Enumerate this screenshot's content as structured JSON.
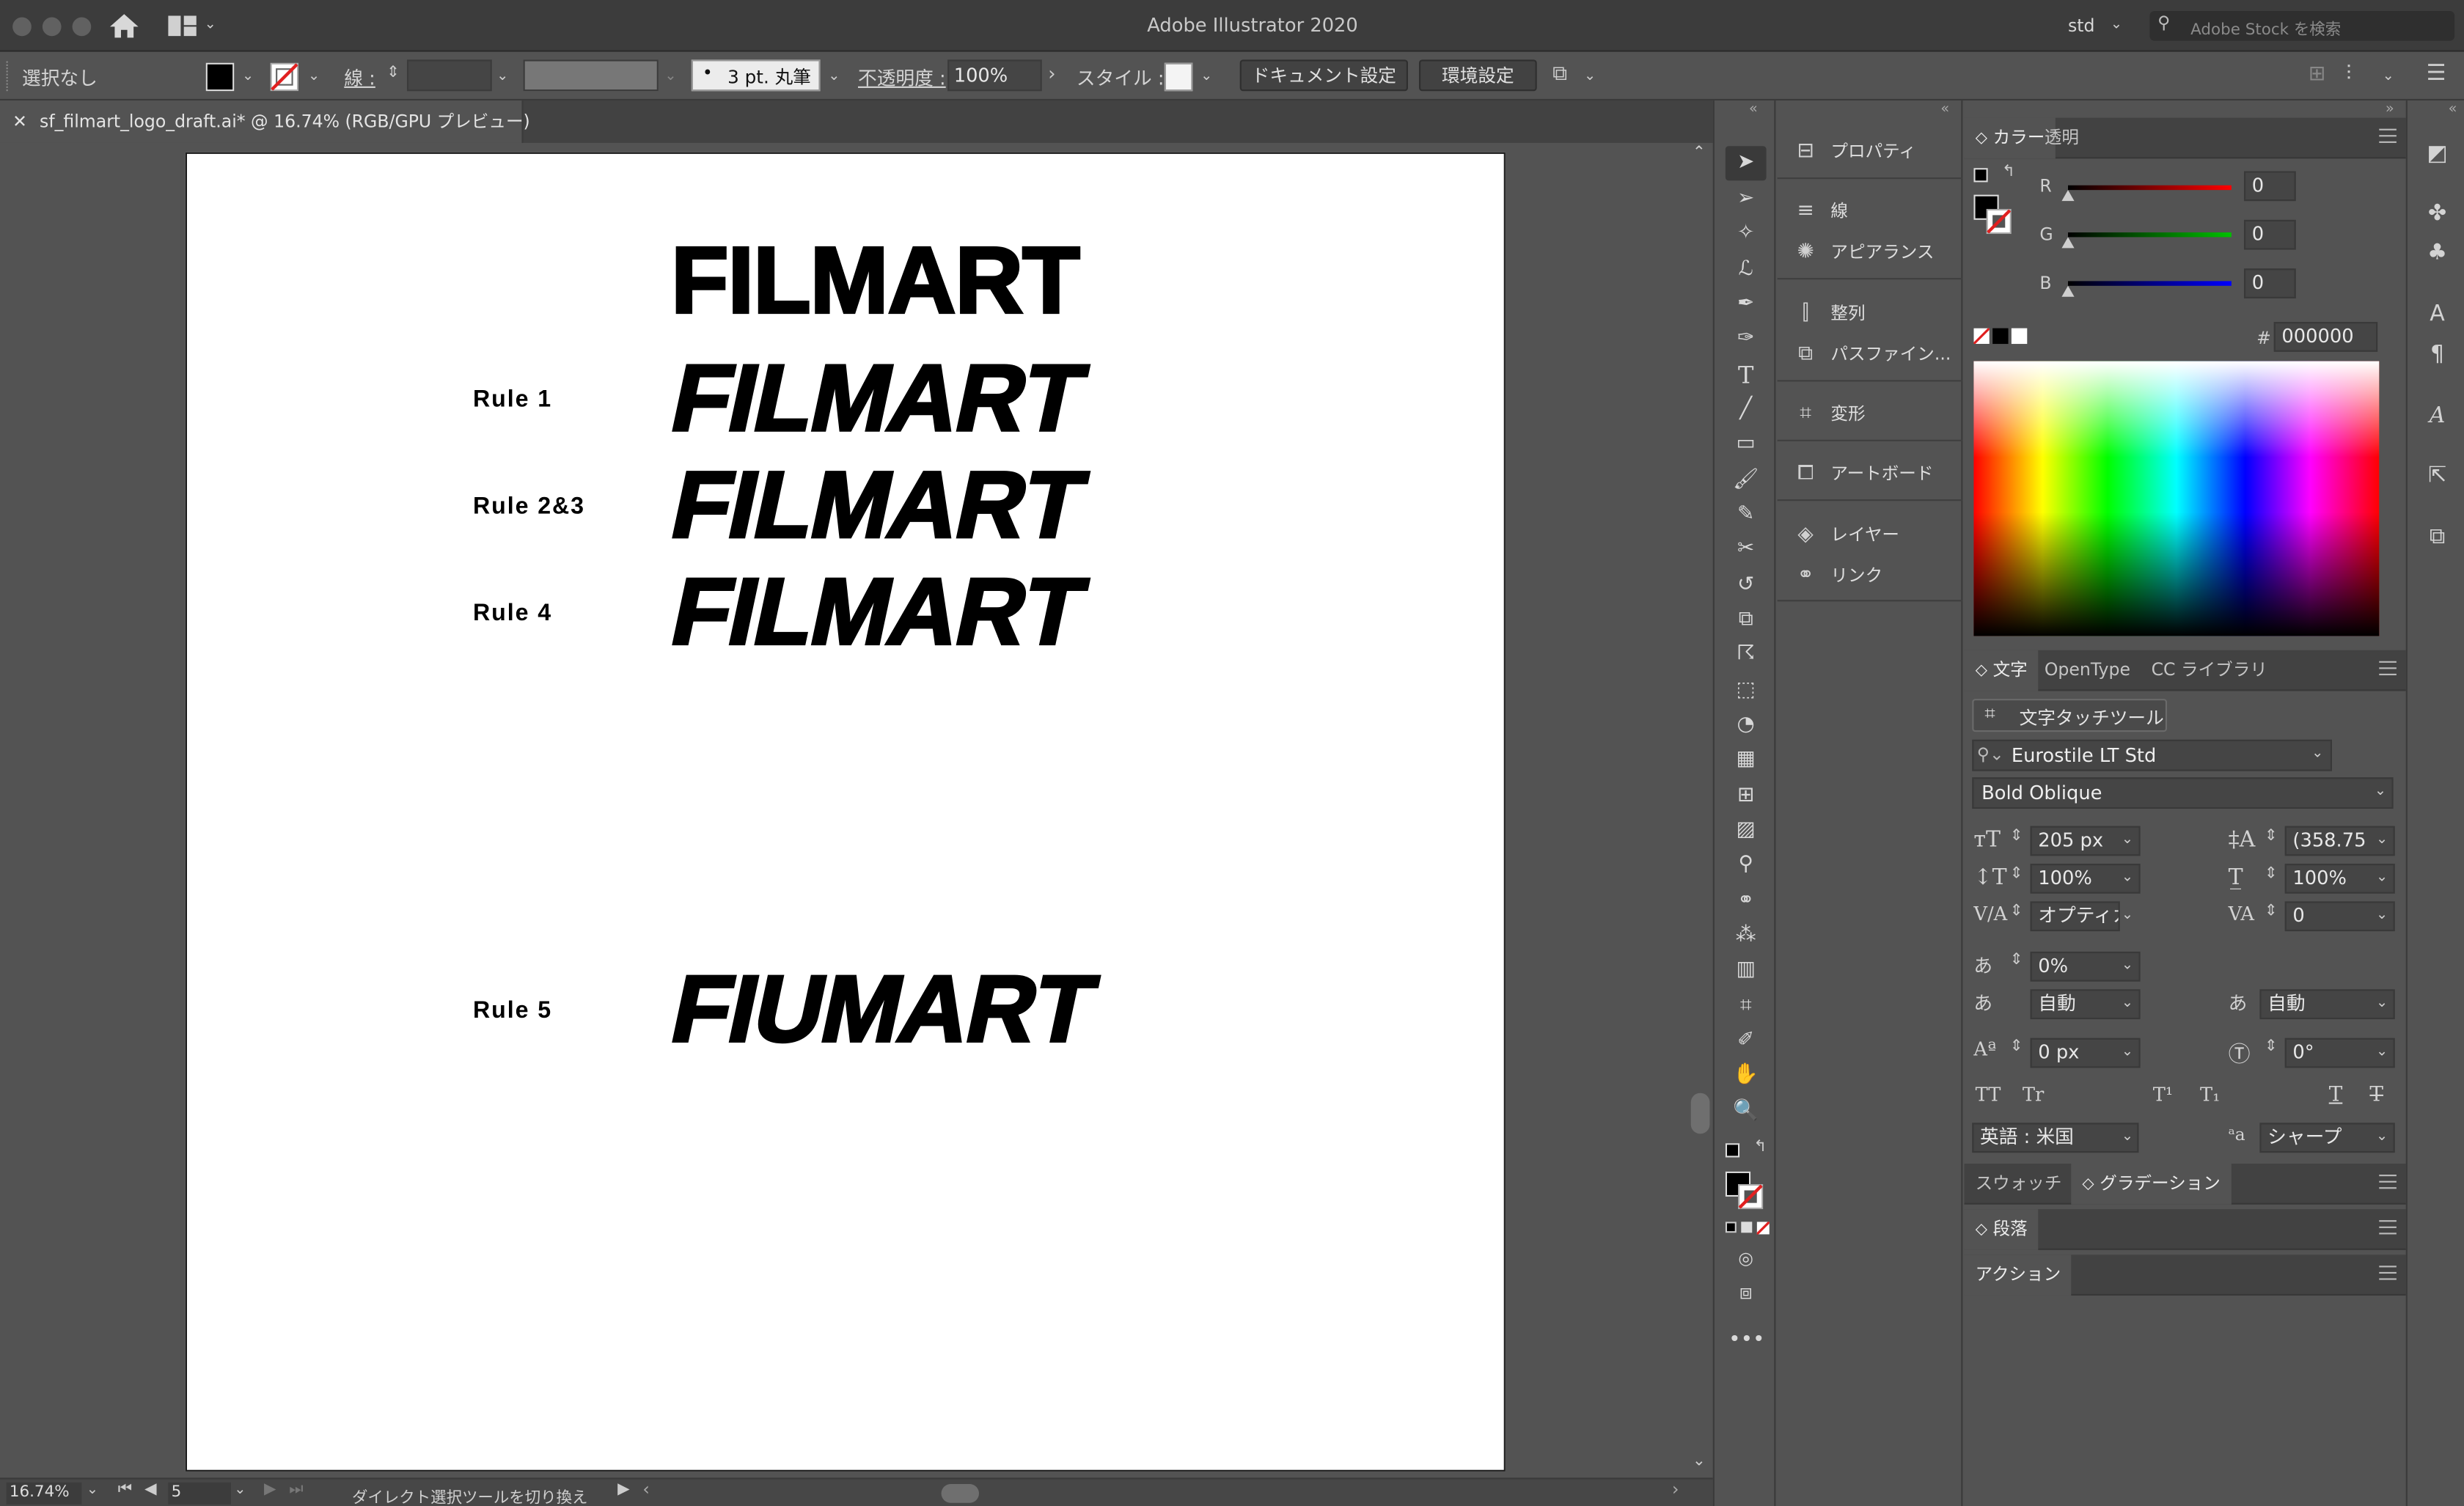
{
  "app": {
    "title": "Adobe Illustrator 2020",
    "workspace": "std",
    "stock_search_placeholder": "Adobe Stock を検索"
  },
  "control_bar": {
    "selection": "選択なし",
    "stroke_label": "線 :",
    "brush": "3 pt. 丸筆",
    "opacity_label": "不透明度 :",
    "opacity": "100%",
    "style_label": "スタイル :",
    "doc_settings": "ドキュメント設定",
    "prefs": "環境設定"
  },
  "document": {
    "tab_title": "sf_filmart_logo_draft.ai* @ 16.74% (RGB/GPU プレビュー)"
  },
  "artboard": {
    "logo_text": "FILMART",
    "logo_text_rule5": "FIUMART",
    "rules": [
      "Rule 1",
      "Rule 2&3",
      "Rule 4",
      "Rule 5"
    ]
  },
  "status_bar": {
    "zoom": "16.74%",
    "artboard_num": "5",
    "status_text": "ダイレクト選択ツールを切り換え"
  },
  "panel_list": {
    "items": [
      "プロパティ",
      "線",
      "アピアランス",
      "整列",
      "パスファイン...",
      "変形",
      "アートボード",
      "レイヤー",
      "リンク"
    ],
    "icons": [
      "properties-icon",
      "stroke-icon",
      "appearance-icon",
      "align-icon",
      "pathfinder-icon",
      "transform-icon",
      "artboard-icon",
      "layers-icon",
      "links-icon"
    ]
  },
  "color_panel": {
    "tabs": [
      "カラー",
      "透明"
    ],
    "r_label": "R",
    "g_label": "G",
    "b_label": "B",
    "r": "0",
    "g": "0",
    "b": "0",
    "hex_label": "#",
    "hex": "000000",
    "slider_colors": {
      "r": "#ff0000",
      "g": "#00c000",
      "b": "#0000ff"
    }
  },
  "character_panel": {
    "tabs": [
      "文字",
      "OpenType",
      "CC ライブラリ"
    ],
    "touch_tool": "文字タッチツール",
    "font_family": "Eurostile LT Std",
    "font_style": "Bold Oblique",
    "font_size": "205 px",
    "leading": "(358.75",
    "vertical_scale": "100%",
    "horizontal_scale": "100%",
    "kerning": "オプティカル",
    "tracking": "0",
    "tsume": "0%",
    "aki_left": "自動",
    "aki_right": "自動",
    "baseline_shift": "0 px",
    "rotation": "0°",
    "language": "英語 : 米国",
    "antialias": "シャープ",
    "style_buttons": [
      "TT",
      "Tr",
      "T¹",
      "T₁",
      "T",
      "T"
    ]
  },
  "swatch_tabs": [
    "スウォッチ",
    "グラデーション"
  ],
  "paragraph_tab": "段落",
  "actions_tab": "アクション"
}
